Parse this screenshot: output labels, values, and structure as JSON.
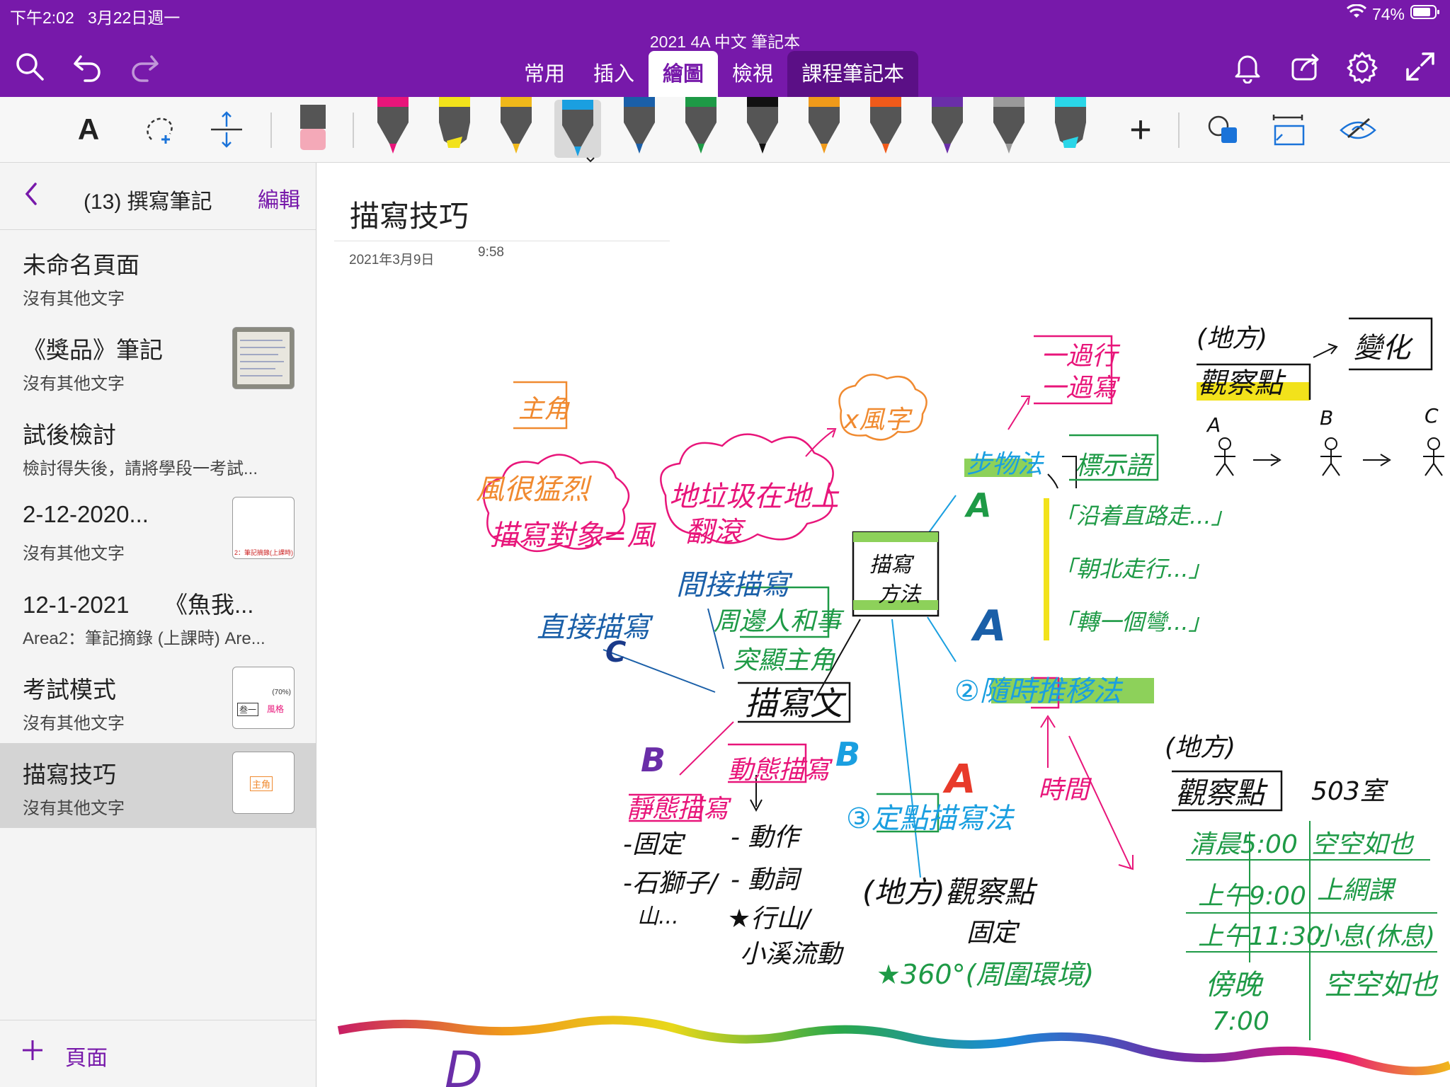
{
  "status_bar": {
    "time": "下午2:02",
    "date": "3月22日週一",
    "battery": "74%"
  },
  "notebook": {
    "title": "2021 4A 中文 筆記本"
  },
  "tabs": [
    {
      "label": "常用"
    },
    {
      "label": "插入"
    },
    {
      "label": "繪圖"
    },
    {
      "label": "檢視"
    },
    {
      "label": "課程筆記本"
    }
  ],
  "ribbon": {
    "text_tool": "A",
    "pen_colors": [
      "#e8157a",
      "#f2e21b",
      "#f0b81a",
      "#1a9fe0",
      "#1a5fa8",
      "#1e9a46",
      "#111111",
      "#f09a1a",
      "#f05a1a",
      "#6a2ea8",
      "#9a9a9a",
      "#2ad6e8"
    ]
  },
  "sidebar": {
    "back_icon": "chevron-left-icon",
    "section_title": "(13) 撰寫筆記",
    "edit_label": "編輯",
    "pages": [
      {
        "title": "未命名頁面",
        "subtitle": "沒有其他文字"
      },
      {
        "title": "《獎品》筆記",
        "subtitle": "沒有其他文字"
      },
      {
        "title": "試後檢討",
        "subtitle": "檢討得失後，請將學段一考試..."
      },
      {
        "title": "2-12-2020...",
        "subtitle": "沒有其他文字",
        "thumb_text": "2：筆記摘錄(上課時)"
      },
      {
        "title": "12-1-2021　　《魚我...",
        "subtitle": "Area2：筆記摘錄 (上課時)  Are..."
      },
      {
        "title": "考試模式",
        "subtitle": "沒有其他文字",
        "thumb_text": "(70%)",
        "thumb_text2": "叁一",
        "thumb_text3": "風格"
      },
      {
        "title": "描寫技巧",
        "subtitle": "沒有其他文字",
        "thumb_text": "主角"
      }
    ],
    "add_page_label": "頁面"
  },
  "page": {
    "title": "描寫技巧",
    "date": "2021年3月9日",
    "time": "9:58"
  },
  "ink": {
    "t_zhujiao": "主角",
    "t_feng_miaoxie": "風很猛烈",
    "t_duixiang": "描寫對象=風",
    "t_xfengzi": "x風字",
    "t_laji": "地垃圾在地上",
    "t_fangun": "翻滾",
    "t_jianjie": "間接描寫",
    "t_zhijie": "直接描寫",
    "t_c": "C",
    "t_zhoubian": "周邊人和事",
    "t_tuxian": "突顯主角",
    "t_miaoxiewen": "描寫文",
    "t_fangfa1": "描寫",
    "t_fangfa2": "方法",
    "t_bu": "步物法",
    "t_A1": "A",
    "t_A2": "A",
    "t_A3": "A",
    "t_guoxing": "一過行",
    "t_guoxie": "一過寫",
    "t_biaoshi": "標示語",
    "t_yanzhe": "「沿着直路走...」",
    "t_chaobei": "「朝北走行...」",
    "t_zhuan": "「轉一個彎...」",
    "t_suishi": "②隨時推移法",
    "t_shijian": "時間",
    "t_difang1": "(地方)",
    "t_guancha1": "觀察點",
    "t_bianhua": "變化",
    "t_pA": "A",
    "t_pB": "B",
    "t_pC": "C",
    "t_B1": "B",
    "t_B2": "B",
    "t_jingtai": "靜態描寫",
    "t_guding1": "-固定",
    "t_shishizi": "-石獅子/",
    "t_shan": "山...",
    "t_dongtai": "動態描寫",
    "t_dongzuo": "- 動作",
    "t_dongci": "- 動詞",
    "t_lie": "★行山/",
    "t_xiaoxi": "小溪流動",
    "t_dingdian": "③定點描寫法",
    "t_guancha2": "(地方)觀察點",
    "t_guding2": "固定",
    "t_360": "★360°(周圍環境)",
    "t_difang2": "(地方)",
    "t_guancha3": "觀察點",
    "t_sch": "503室",
    "t_r1a": "清晨5:00",
    "t_r1b": "空空如也",
    "t_r2a": "上午9:00",
    "t_r2b": "上網課",
    "t_r3a": "上午11:30",
    "t_r3b": "小息(休息)",
    "t_r4a": "傍晚",
    "t_r4c": "7:00",
    "t_r4b": "空空如也",
    "t_D": "D"
  }
}
